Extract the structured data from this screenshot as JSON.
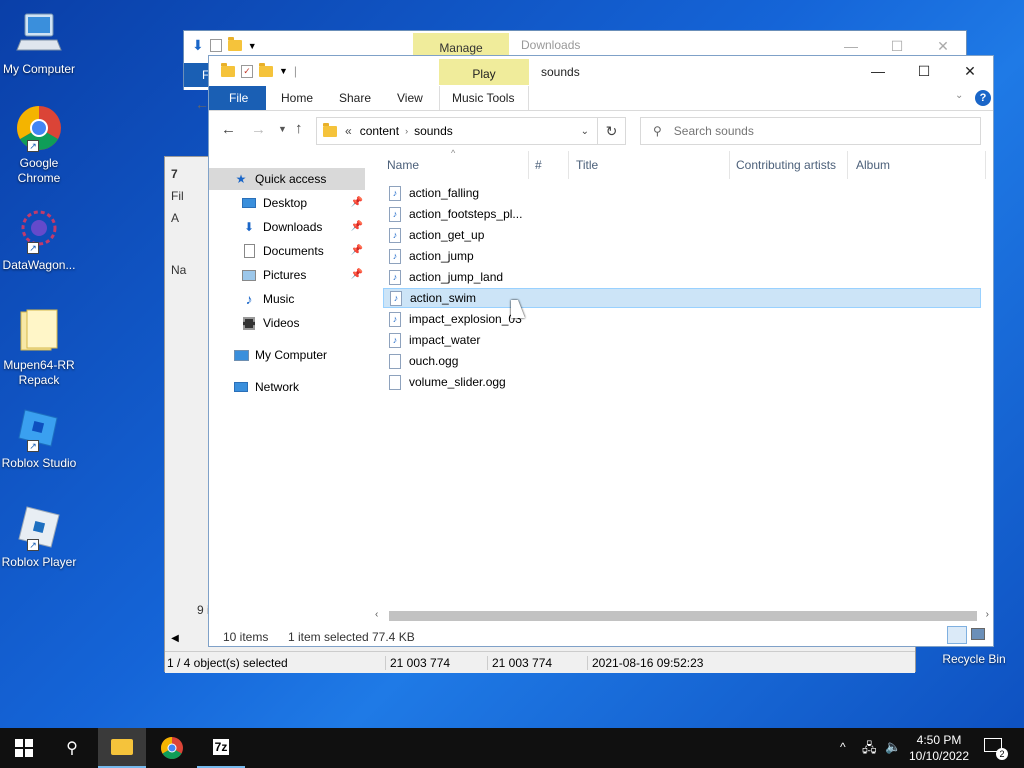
{
  "desktop": {
    "icons": [
      {
        "label": "My Computer"
      },
      {
        "label": "Google\nChrome"
      },
      {
        "label": "DataWagon..."
      },
      {
        "label": "Mupen64-RR\nRepack"
      },
      {
        "label": "Roblox Studio"
      },
      {
        "label": "Roblox Player"
      }
    ],
    "recycle_bin": "Recycle Bin"
  },
  "back_window": {
    "context_tab": "Manage",
    "title": "Downloads",
    "file_tab": "F",
    "side_labels": [
      "7",
      "Fil",
      "A",
      "Na"
    ],
    "status_count": "9 i",
    "statusbar": {
      "selected": "1 / 4 object(s) selected",
      "size1": "21 003 774",
      "size2": "21 003 774",
      "date": "2021-08-16 09:52:23"
    }
  },
  "explorer": {
    "context_tab": "Play",
    "title": "sounds",
    "tabs": {
      "file": "File",
      "home": "Home",
      "share": "Share",
      "view": "View",
      "music_tools": "Music Tools"
    },
    "breadcrumb": {
      "prefix": "«",
      "part1": "content",
      "part2": "sounds"
    },
    "search_placeholder": "Search sounds",
    "nav": {
      "quick_access": "Quick access",
      "desktop": "Desktop",
      "downloads": "Downloads",
      "documents": "Documents",
      "pictures": "Pictures",
      "music": "Music",
      "videos": "Videos",
      "my_computer": "My Computer",
      "network": "Network"
    },
    "columns": {
      "name": "Name",
      "number": "#",
      "title": "Title",
      "artists": "Contributing artists",
      "album": "Album"
    },
    "files": [
      {
        "name": "action_falling",
        "type": "audio"
      },
      {
        "name": "action_footsteps_pl...",
        "type": "audio"
      },
      {
        "name": "action_get_up",
        "type": "audio"
      },
      {
        "name": "action_jump",
        "type": "audio"
      },
      {
        "name": "action_jump_land",
        "type": "audio"
      },
      {
        "name": "action_swim",
        "type": "audio"
      },
      {
        "name": "impact_explosion_03",
        "type": "audio"
      },
      {
        "name": "impact_water",
        "type": "audio"
      },
      {
        "name": "ouch.ogg",
        "type": "blank"
      },
      {
        "name": "volume_slider.ogg",
        "type": "blank"
      }
    ],
    "status": {
      "count": "10 items",
      "selected": "1 item selected",
      "size": "77.4 KB"
    }
  },
  "taskbar": {
    "time": "4:50 PM",
    "date": "10/10/2022",
    "notifications": "2",
    "app_7z": "7z"
  },
  "colors": {
    "accent": "#1a5fb4",
    "selection": "#cce4f7",
    "context_tab": "#f0ec9b"
  }
}
